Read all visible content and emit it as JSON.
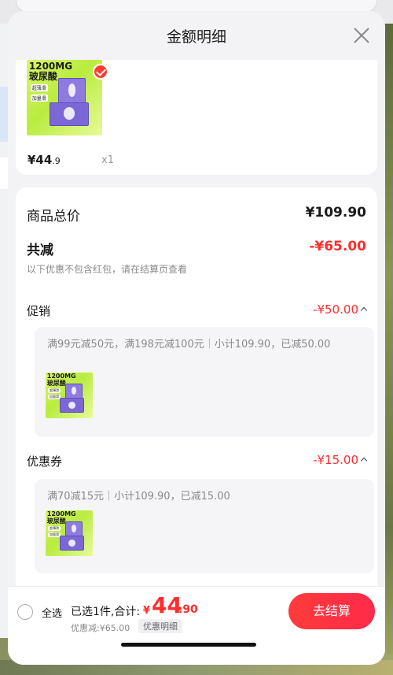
{
  "sheet": {
    "title": "金额明细"
  },
  "product": {
    "image_brand_line1": "1200MG",
    "image_brand_line2": "玻尿酸",
    "image_tag1": "超薄滑",
    "image_tag2": "加量滑",
    "price_int": "¥44",
    "price_dec": ".9",
    "qty": "x1"
  },
  "summary": {
    "total_label": "商品总价",
    "total_value": "¥109.90",
    "reduce_label": "共减",
    "reduce_value": "-¥65.00",
    "note": "以下优惠不包含红包，请在结算页查看"
  },
  "promotion": {
    "title": "促销",
    "value": "-¥50.00",
    "detail": "满99元减50元，满198元减100元｜小计109.90，已减50.00"
  },
  "coupon": {
    "title": "优惠券",
    "value": "-¥15.00",
    "detail": "满70减15元｜小计109.90，已减15.00"
  },
  "bottom_bar": {
    "select_all": "全选",
    "selected_count": "已选1件,合计:",
    "sum_yen": "¥",
    "sum_int": "44",
    "sum_dec": ".90",
    "discount": "优惠减:¥65.00",
    "detail_tag": "优惠明细",
    "checkout": "去结算"
  },
  "colors": {
    "accent_red": "#ff2d2d",
    "sheet_bg": "#f3f3f5",
    "card_bg": "#ffffff"
  }
}
